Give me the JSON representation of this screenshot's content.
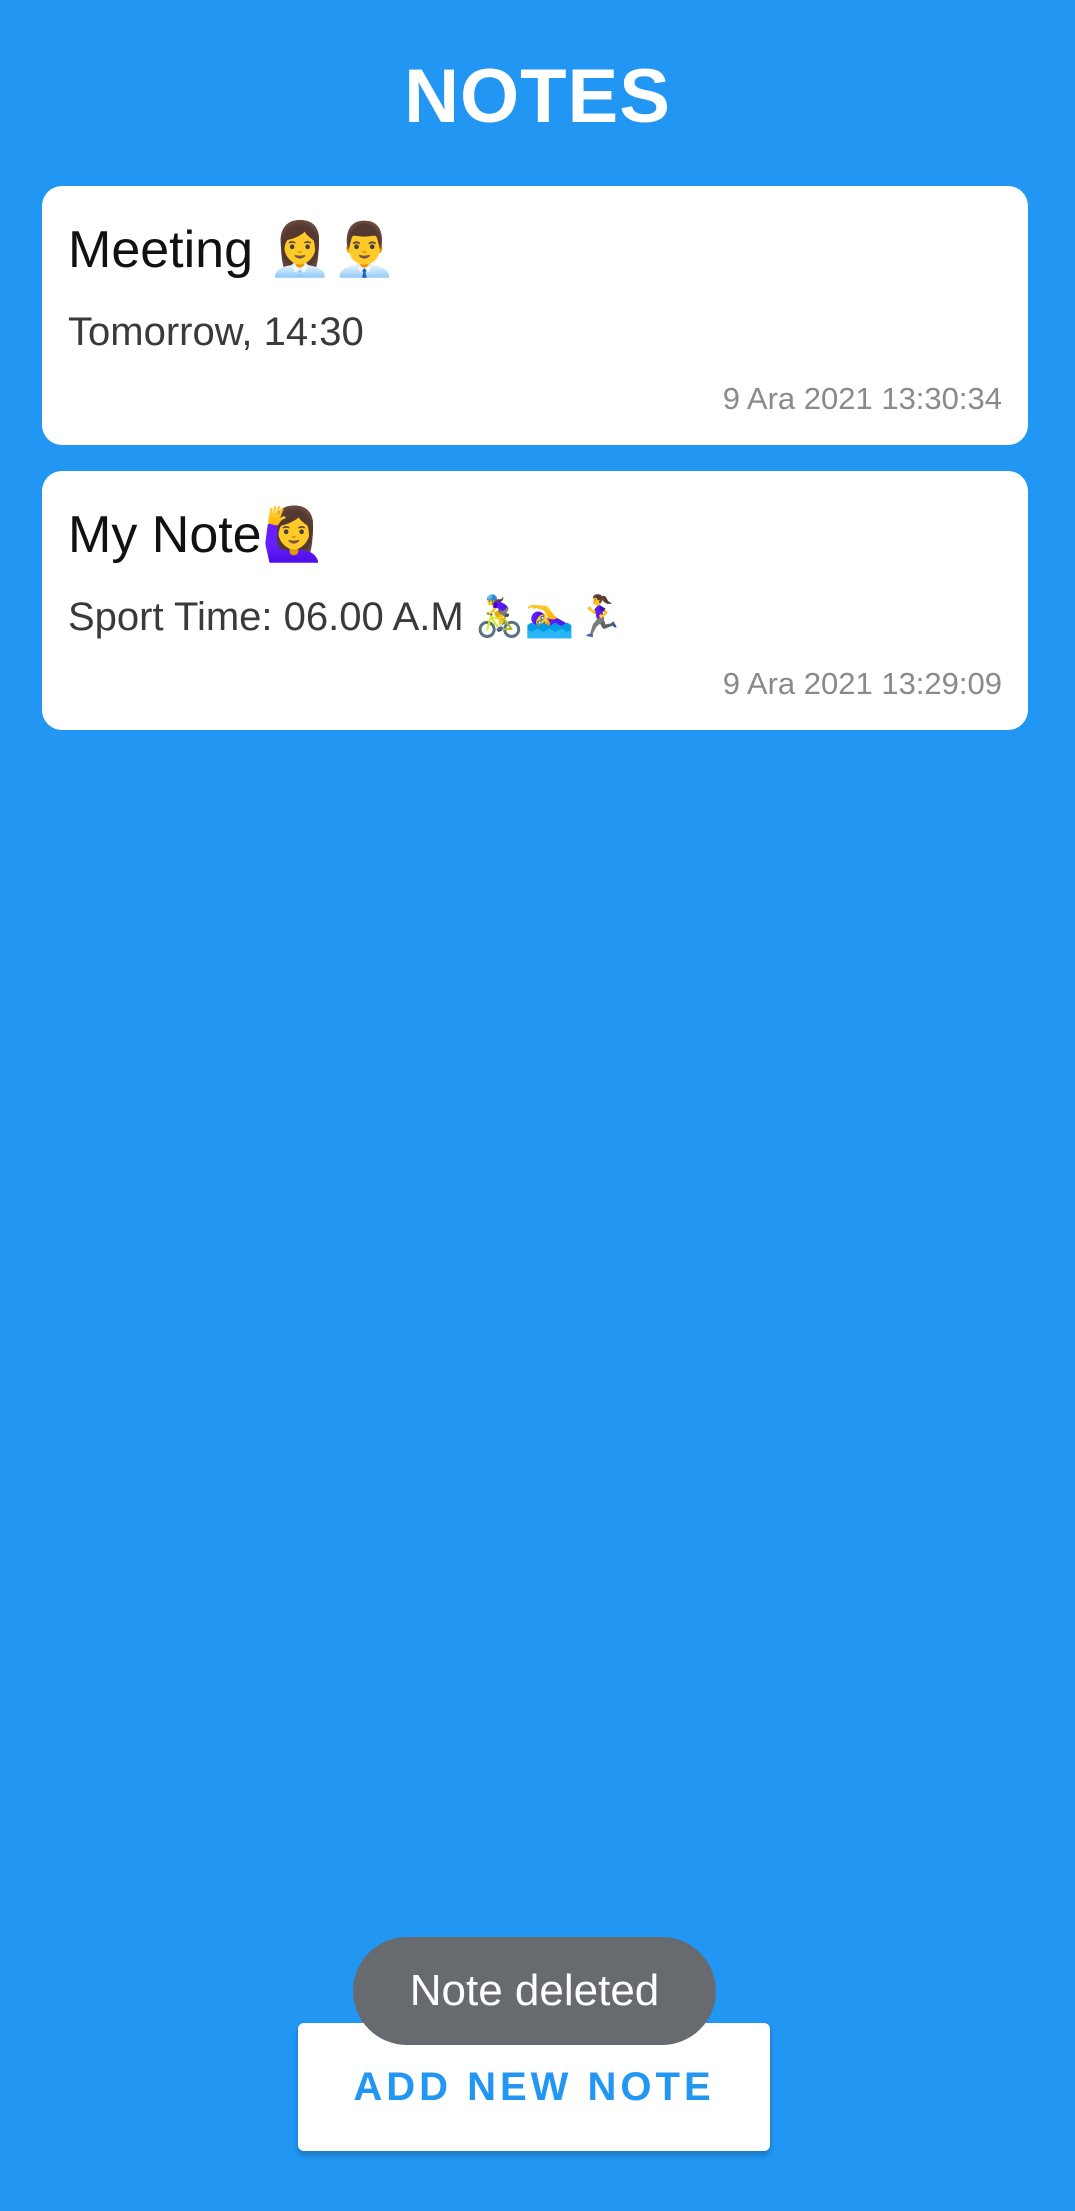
{
  "header": {
    "title": "NOTES"
  },
  "notes": [
    {
      "title": "Meeting 👩‍💼👨‍💼",
      "body": "Tomorrow, 14:30",
      "date": "9 Ara 2021 13:30:34"
    },
    {
      "title": "My Note🙋‍♀️",
      "body": "Sport Time: 06.00 A.M 🚴‍♀️🏊‍♀️🏃‍♀️",
      "date": "9 Ara 2021 13:29:09"
    }
  ],
  "actions": {
    "add_note_label": "ADD NEW NOTE"
  },
  "toast": {
    "message": "Note deleted"
  },
  "colors": {
    "background": "#2196F3",
    "accent": "#2196F3",
    "card": "#FFFFFF",
    "toast": "#676B6F"
  }
}
